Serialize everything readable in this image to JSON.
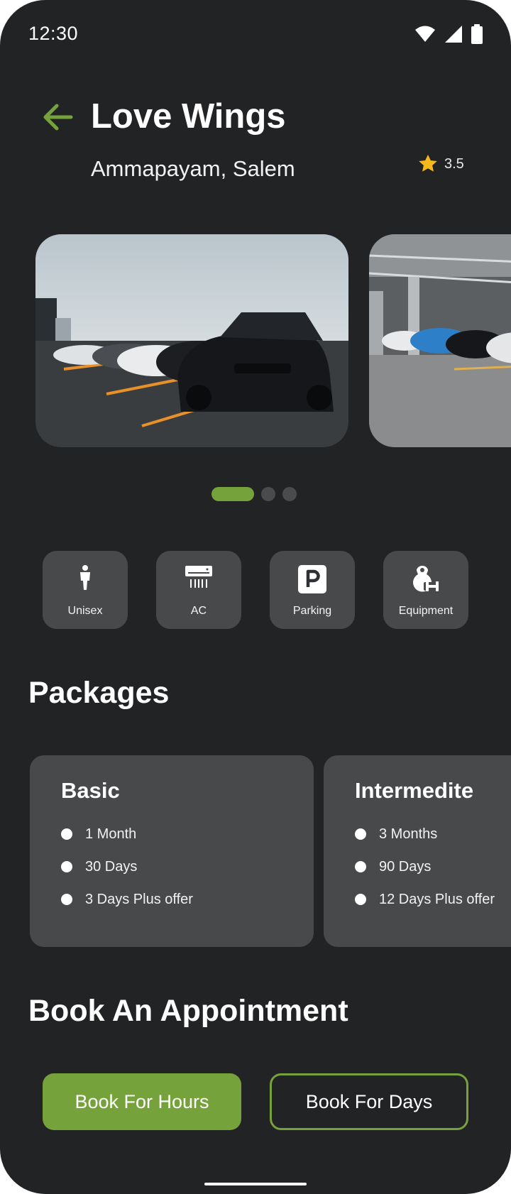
{
  "status_bar": {
    "time": "12:30"
  },
  "header": {
    "title": "Love Wings",
    "location": "Ammapayam, Salem",
    "rating": "3.5"
  },
  "carousel": {
    "slide_count": 3,
    "active_index": 0
  },
  "amenities": [
    {
      "label": "Unisex",
      "icon": "person-icon"
    },
    {
      "label": "AC",
      "icon": "air-conditioner-icon"
    },
    {
      "label": "Parking",
      "icon": "parking-icon"
    },
    {
      "label": "Equipment",
      "icon": "kettlebell-dumbbell-icon"
    }
  ],
  "packages": {
    "title": "Packages",
    "items": [
      {
        "name": "Basic",
        "features": [
          "1 Month",
          "30 Days",
          "3 Days Plus offer"
        ]
      },
      {
        "name": "Intermedite",
        "features": [
          "3 Months",
          "90 Days",
          "12 Days Plus offer"
        ]
      }
    ]
  },
  "appointment": {
    "title": "Book An Appointment",
    "book_hours_label": "Book For Hours",
    "book_days_label": "Book For Days"
  },
  "colors": {
    "background": "#222325",
    "card": "#48494b",
    "accent": "#76a23c",
    "star": "#f5b81c"
  }
}
